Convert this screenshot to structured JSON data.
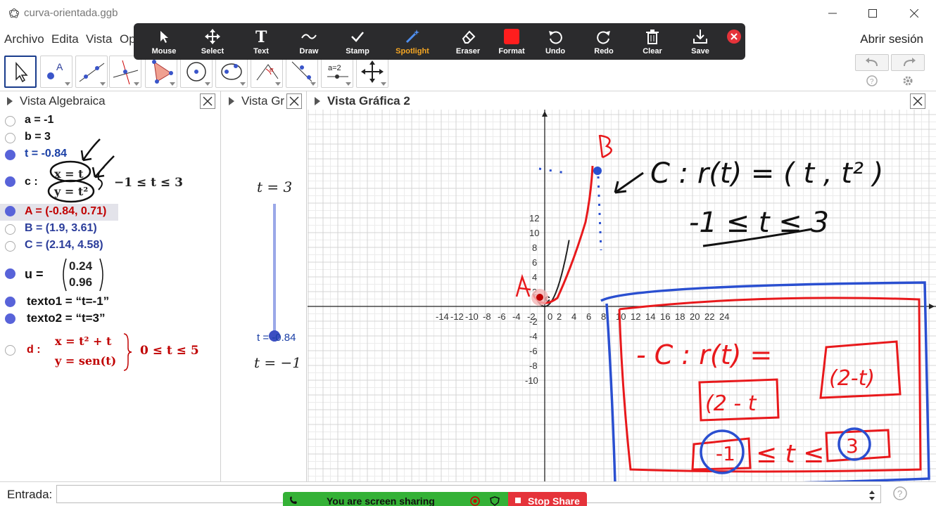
{
  "window": {
    "title": "curva-orientada.ggb"
  },
  "menu": {
    "items": [
      "Archivo",
      "Edita",
      "Vista",
      "Op"
    ],
    "signin": "Abrir sesión"
  },
  "annotation_toolbar": {
    "tools": [
      {
        "label": "Mouse",
        "icon": "cursor-icon"
      },
      {
        "label": "Select",
        "icon": "move-cross-icon"
      },
      {
        "label": "Text",
        "icon": "text-t-icon"
      },
      {
        "label": "Draw",
        "icon": "squiggle-icon"
      },
      {
        "label": "Stamp",
        "icon": "checkmark-icon"
      },
      {
        "label": "Spotlight",
        "icon": "magic-wand-icon"
      },
      {
        "label": "Eraser",
        "icon": "eraser-icon"
      },
      {
        "label": "Format",
        "icon": "color-square-icon"
      },
      {
        "label": "Undo",
        "icon": "undo-arrow-icon"
      },
      {
        "label": "Redo",
        "icon": "redo-arrow-icon"
      },
      {
        "label": "Clear",
        "icon": "trash-icon"
      },
      {
        "label": "Save",
        "icon": "download-icon"
      }
    ],
    "active": "Spotlight",
    "format_color": "#ff1e1e"
  },
  "panels": {
    "algebra": {
      "title": "Vista Algebraica",
      "rows": [
        {
          "text": "a = -1",
          "color": "#111111",
          "visible": false
        },
        {
          "text": "b = 3",
          "color": "#111111",
          "visible": false
        },
        {
          "text": "t = -0.84",
          "color": "#1a3fa6",
          "visible": true
        },
        {
          "text": "c :",
          "color": "#111111",
          "visible": true,
          "system": [
            "x = t",
            "y = t²"
          ],
          "range": "−1 ≤ t ≤ 3"
        },
        {
          "text": "A = (-0.84, 0.71)",
          "color": "#c00000",
          "visible": true,
          "highlighted": true
        },
        {
          "text": "B = (1.9, 3.61)",
          "color": "#2a3c9a",
          "visible": false
        },
        {
          "text": "C = (2.14, 4.58)",
          "color": "#2a3c9a",
          "visible": false
        },
        {
          "text": "u =",
          "color": "#111111",
          "visible": true,
          "vector": [
            "0.24",
            "0.96"
          ]
        },
        {
          "text": "texto1  =  “t=-1”",
          "color": "#111111",
          "visible": true
        },
        {
          "text": "texto2  =  “t=3”",
          "color": "#111111",
          "visible": true
        },
        {
          "text": "d :",
          "color": "#c00000",
          "visible": false,
          "system": [
            "x = t² + t",
            "y = sen(t)"
          ],
          "range": "0 ≤ t ≤ 5"
        }
      ]
    },
    "graphics1": {
      "title": "Vista Gr",
      "top_text": "t = 3",
      "bottom_text": "t = −1",
      "slider_label": "t = -0.84",
      "slider_value": -0.84,
      "slider_min": -1,
      "slider_max": 3
    },
    "graphics2": {
      "title": "Vista Gráfica 2",
      "x_ticks": [
        "-14",
        "-12",
        "-10",
        "-8",
        "-6",
        "-4",
        "-2",
        "0",
        "2",
        "4",
        "6",
        "8",
        "10",
        "12",
        "14",
        "16",
        "18",
        "20",
        "22",
        "24"
      ],
      "y_ticks": [
        "12",
        "10",
        "8",
        "6",
        "4",
        "2",
        "-2",
        "-4",
        "-6",
        "-8",
        "-10"
      ],
      "curve_label": "c"
    }
  },
  "input_bar": {
    "label": "Entrada:"
  },
  "screen_share": {
    "message": "You are screen sharing",
    "stop_label": "Stop Share"
  },
  "colors": {
    "accent_blue": "#1a3c8c",
    "curve_red": "#e8191c",
    "point_blue": "#2a4fd0",
    "spotlight_orange": "#f5a623"
  }
}
